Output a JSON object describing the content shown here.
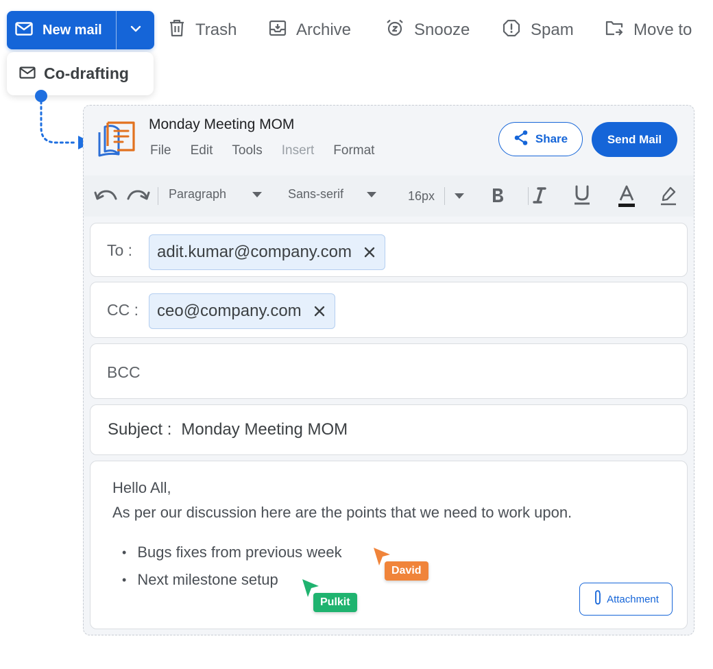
{
  "colors": {
    "accent": "#1565d8",
    "david": "#f0843a",
    "pulkit": "#1fb36f",
    "app_icon": "#e2721f"
  },
  "toolbar": {
    "new_mail_label": "New mail",
    "items": [
      {
        "label": "Trash",
        "icon": "trash-icon"
      },
      {
        "label": "Archive",
        "icon": "archive-icon"
      },
      {
        "label": "Snooze",
        "icon": "alarm-clock-icon"
      },
      {
        "label": "Spam",
        "icon": "warning-octagon-icon"
      },
      {
        "label": "Move to",
        "icon": "folder-move-icon"
      }
    ]
  },
  "dropdown": {
    "item_label": "Co-drafting",
    "icon": "mail-icon"
  },
  "editor": {
    "title": "Monday Meeting MOM",
    "menu": [
      "File",
      "Edit",
      "Tools",
      "Insert",
      "Format"
    ],
    "share_label": "Share",
    "send_label": "Send Mail",
    "format": {
      "block_style": "Paragraph",
      "font_family": "Sans-serif",
      "font_size": "16px"
    }
  },
  "fields": {
    "to_label": "To :",
    "to_recipients": [
      "adit.kumar@company.com"
    ],
    "cc_label": "CC :",
    "cc_recipients": [
      "ceo@company.com"
    ],
    "bcc_label": "BCC",
    "subject_label": "Subject :",
    "subject_value": "Monday Meeting MOM"
  },
  "body": {
    "greeting": "Hello All,",
    "intro": "As per our discussion here are the points that we need to work upon.",
    "bullets": [
      "Bugs fixes from previous week",
      "Next milestone setup"
    ],
    "attachment_label": "Attachment"
  },
  "collaborators": [
    {
      "name": "David",
      "color": "#f0843a"
    },
    {
      "name": "Pulkit",
      "color": "#1fb36f"
    }
  ]
}
